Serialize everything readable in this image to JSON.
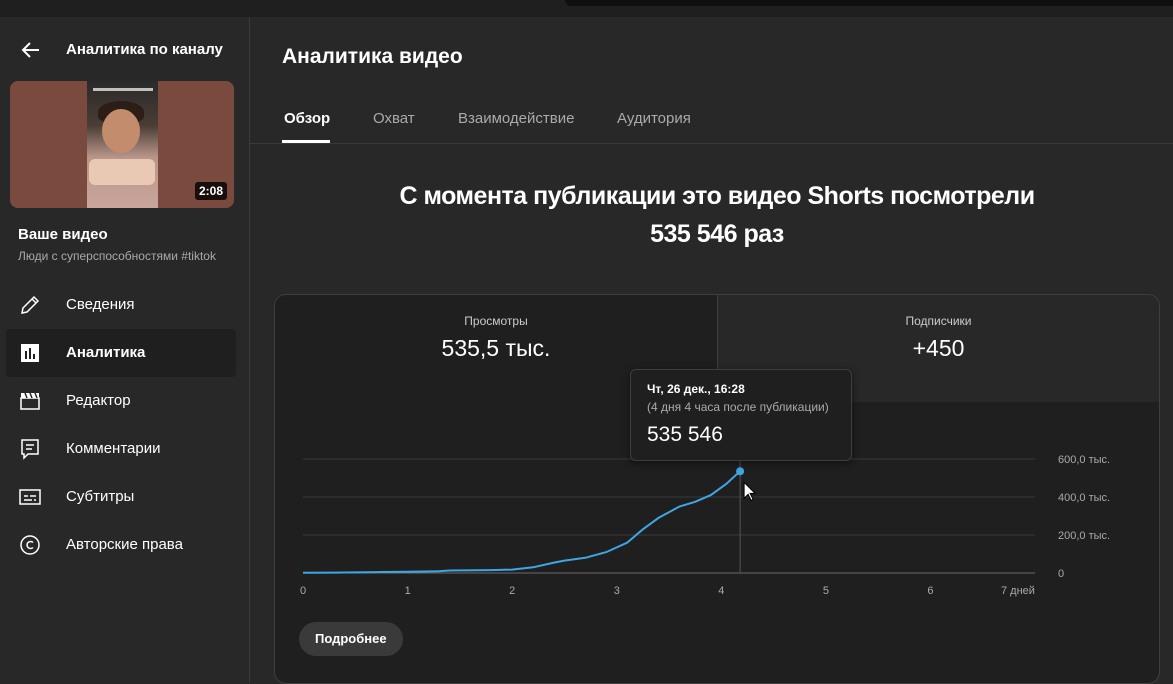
{
  "sidebar": {
    "title": "Аналитика по каналу",
    "thumbnail_duration": "2:08",
    "your_video_label": "Ваше видео",
    "video_title": "Люди с суперспособностями #tiktok",
    "items": [
      {
        "label": "Сведения",
        "icon": "pencil-icon"
      },
      {
        "label": "Аналитика",
        "icon": "analytics-icon",
        "active": true
      },
      {
        "label": "Редактор",
        "icon": "clapperboard-icon"
      },
      {
        "label": "Комментарии",
        "icon": "comment-icon"
      },
      {
        "label": "Субтитры",
        "icon": "subtitles-icon"
      },
      {
        "label": "Авторские права",
        "icon": "copyright-icon"
      }
    ]
  },
  "main": {
    "title": "Аналитика видео",
    "tabs": [
      "Обзор",
      "Охват",
      "Взаимодействие",
      "Аудитория"
    ],
    "active_tab": "Обзор",
    "headline_line1": "С момента публикации это видео Shorts посмотрели",
    "headline_line2": "535 546 раз",
    "metrics": [
      {
        "label": "Просмотры",
        "value": "535,5 тыс."
      },
      {
        "label": "Подписчики",
        "value": "+450"
      }
    ],
    "tooltip": {
      "date": "Чт, 26 дек., 16:28",
      "subtitle": "(4 дня 4 часа после публикации)",
      "value": "535 546"
    },
    "more_button": "Подробнее"
  },
  "colors": {
    "line": "#3ea6e3",
    "background": "#282828",
    "card": "#1f1f1f"
  },
  "chart_data": {
    "type": "line",
    "x_unit": "дней",
    "x_ticks": [
      "0",
      "1",
      "2",
      "3",
      "4",
      "5",
      "6",
      "7 дней"
    ],
    "y_ticks": [
      "0",
      "200,0 тыс.",
      "400,0 тыс.",
      "600,0 тыс."
    ],
    "xlim": [
      0,
      7
    ],
    "ylim": [
      0,
      600000
    ],
    "series": [
      {
        "x": [
          0,
          0.3,
          0.7,
          1.0,
          1.3,
          1.4,
          1.8,
          2.0,
          2.2,
          2.4,
          2.5,
          2.7,
          2.9,
          3.1,
          3.25,
          3.4,
          3.6,
          3.75,
          3.9,
          4.05,
          4.18
        ],
        "y": [
          1000,
          2000,
          5000,
          7000,
          9000,
          13000,
          15000,
          18000,
          30000,
          55000,
          65000,
          80000,
          110000,
          160000,
          230000,
          290000,
          350000,
          375000,
          410000,
          470000,
          535546
        ]
      }
    ],
    "hover_x": 4.18,
    "grid": true
  }
}
